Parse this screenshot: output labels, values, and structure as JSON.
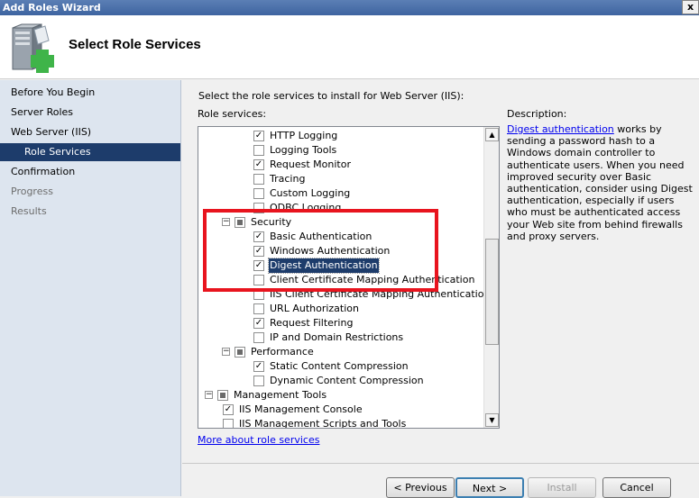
{
  "window": {
    "title": "Add Roles Wizard",
    "close_glyph": "x"
  },
  "header": {
    "title": "Select Role Services",
    "icon": "server-add-icon"
  },
  "nav": [
    {
      "label": "Before You Begin",
      "state": "normal"
    },
    {
      "label": "Server Roles",
      "state": "normal"
    },
    {
      "label": "Web Server (IIS)",
      "state": "normal"
    },
    {
      "label": "Role Services",
      "state": "active"
    },
    {
      "label": "Confirmation",
      "state": "normal"
    },
    {
      "label": "Progress",
      "state": "disabled"
    },
    {
      "label": "Results",
      "state": "disabled"
    }
  ],
  "content": {
    "intro": "Select the role services to install for Web Server (IIS):",
    "list_label": "Role services:",
    "description_title": "Description:",
    "description_link": "Digest authentication",
    "description_text": " works by sending a password hash to a Windows domain controller to authenticate users. When you need improved security over Basic authentication, consider using Digest authentication, especially if users who must be authenticated access your Web site from behind firewalls and proxy servers.",
    "more_link": "More about role services"
  },
  "tree": [
    {
      "label": "HTTP Logging",
      "level": 2,
      "state": "checked"
    },
    {
      "label": "Logging Tools",
      "level": 2,
      "state": "unchecked"
    },
    {
      "label": "Request Monitor",
      "level": 2,
      "state": "checked"
    },
    {
      "label": "Tracing",
      "level": 2,
      "state": "unchecked"
    },
    {
      "label": "Custom Logging",
      "level": 2,
      "state": "unchecked"
    },
    {
      "label": "ODBC Logging",
      "level": 2,
      "state": "unchecked"
    },
    {
      "label": "Security",
      "level": 1,
      "state": "partial",
      "expander": "−"
    },
    {
      "label": "Basic Authentication",
      "level": 2,
      "state": "checked"
    },
    {
      "label": "Windows Authentication",
      "level": 2,
      "state": "checked"
    },
    {
      "label": "Digest Authentication",
      "level": 2,
      "state": "checked",
      "selected": true
    },
    {
      "label": "Client Certificate Mapping Authentication",
      "level": 2,
      "state": "unchecked"
    },
    {
      "label": "IIS Client Certificate Mapping Authentication",
      "level": 2,
      "state": "unchecked"
    },
    {
      "label": "URL Authorization",
      "level": 2,
      "state": "unchecked"
    },
    {
      "label": "Request Filtering",
      "level": 2,
      "state": "checked"
    },
    {
      "label": "IP and Domain Restrictions",
      "level": 2,
      "state": "unchecked"
    },
    {
      "label": "Performance",
      "level": 1,
      "state": "partial",
      "expander": "−"
    },
    {
      "label": "Static Content Compression",
      "level": 2,
      "state": "checked"
    },
    {
      "label": "Dynamic Content Compression",
      "level": 2,
      "state": "unchecked"
    },
    {
      "label": "Management Tools",
      "level": 0,
      "state": "partial",
      "expander": "−"
    },
    {
      "label": "IIS Management Console",
      "level": 1,
      "state": "checked"
    },
    {
      "label": "IIS Management Scripts and Tools",
      "level": 1,
      "state": "unchecked"
    }
  ],
  "scroll": {
    "up_glyph": "▲",
    "down_glyph": "▼"
  },
  "buttons": {
    "previous": "< Previous",
    "next": "Next >",
    "install": "Install",
    "cancel": "Cancel"
  },
  "colors": {
    "selection": "#1d3c6b",
    "annotation_red": "#e8141e",
    "nav_bg": "#dde5ef"
  }
}
